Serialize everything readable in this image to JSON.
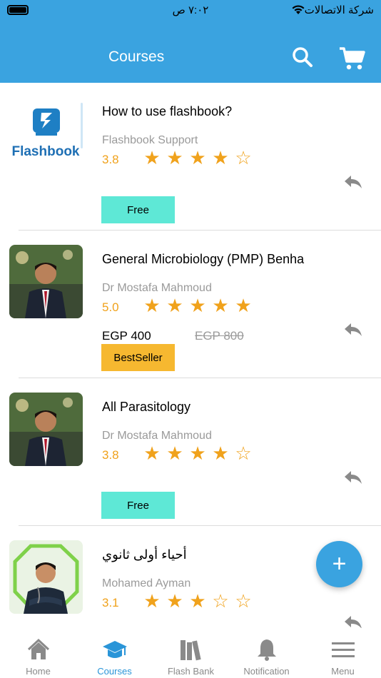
{
  "status_bar": {
    "time": "٧:٠٢ ص",
    "carrier": "شركة الاتصالات"
  },
  "header": {
    "title": "Courses",
    "search_icon": "search-icon",
    "cart_icon": "cart-icon"
  },
  "courses": [
    {
      "title": "How to use flashbook?",
      "author": "Flashbook Support",
      "rating": "3.8",
      "stars": 4,
      "price": "",
      "old_price": "",
      "badge": "Free",
      "logo_text": "Flashbook"
    },
    {
      "title": "General Microbiology (PMP) Benha",
      "author": "Dr Mostafa Mahmoud",
      "rating": "5.0",
      "stars": 5,
      "price": "EGP 400",
      "old_price": "EGP 800",
      "badge": "BestSeller"
    },
    {
      "title": "All Parasitology",
      "author": "Dr Mostafa Mahmoud",
      "rating": "3.8",
      "stars": 4,
      "price": "",
      "old_price": "",
      "badge": "Free"
    },
    {
      "title": "أحياء أولى ثانوي",
      "author": "Mohamed Ayman",
      "rating": "3.1",
      "stars": 3,
      "price": "",
      "old_price": "",
      "badge": ""
    }
  ],
  "fab": {
    "label": "+"
  },
  "tabs": [
    {
      "label": "Home",
      "icon": "home-icon",
      "active": false
    },
    {
      "label": "Courses",
      "icon": "graduation-cap-icon",
      "active": true
    },
    {
      "label": "Flash Bank",
      "icon": "books-icon",
      "active": false
    },
    {
      "label": "Notification",
      "icon": "bell-icon",
      "active": false
    },
    {
      "label": "Menu",
      "icon": "hamburger-icon",
      "active": false
    }
  ],
  "colors": {
    "brand": "#3aa3e0",
    "free_badge": "#5ee8d6",
    "bestseller_badge": "#f6b830",
    "star": "#f0a21c"
  }
}
